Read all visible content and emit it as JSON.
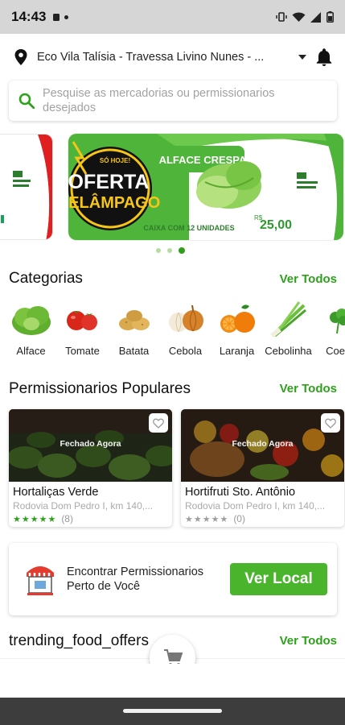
{
  "status_bar": {
    "time": "14:43"
  },
  "location": {
    "address": "Eco Vila Talísia - Travessa Livino Nunes - ..."
  },
  "search": {
    "placeholder": "Pesquise as mercadorias ou permissionarios desejados"
  },
  "banner": {
    "badge_top": "SÓ HOJE!",
    "offer_line1": "OFERTA",
    "offer_line2": "RELÂMPAGO",
    "product": "ALFACE CRESPA",
    "box_text": "CAIXA COM 12 UNIDADES",
    "price_prefix": "R$",
    "price": "25,00",
    "page_count": 3,
    "active_page": 3
  },
  "categories": {
    "title": "Categorias",
    "see_all": "Ver Todos",
    "items": [
      {
        "label": "Alface",
        "icon": "lettuce-icon"
      },
      {
        "label": "Tomate",
        "icon": "tomato-icon"
      },
      {
        "label": "Batata",
        "icon": "potato-icon"
      },
      {
        "label": "Cebola",
        "icon": "onion-icon"
      },
      {
        "label": "Laranja",
        "icon": "orange-icon"
      },
      {
        "label": "Cebolinha",
        "icon": "chives-icon"
      },
      {
        "label": "Coent",
        "icon": "coriander-icon"
      }
    ]
  },
  "popular": {
    "title": "Permissionarios Populares",
    "see_all": "Ver Todos",
    "stores": [
      {
        "name": "Hortaliças Verde",
        "address": "Rodovia Dom Pedro I, km 140,...",
        "status": "Fechado Agora",
        "stars": 5,
        "reviews": "(8)"
      },
      {
        "name": "Hortifruti Sto. Antônio",
        "address": "Rodovia Dom Pedro I, km 140,...",
        "status": "Fechado Agora",
        "stars": 0,
        "reviews": "(0)"
      }
    ]
  },
  "nearby": {
    "text": "Encontrar Permissionarios Perto de Você",
    "button": "Ver Local"
  },
  "trending": {
    "title": "trending_food_offers",
    "see_all": "Ver Todos"
  },
  "colors": {
    "accent": "#2ea11b",
    "button": "#4ab52c",
    "star_filled": "#2ea11b",
    "star_empty": "#9e9e9e"
  }
}
